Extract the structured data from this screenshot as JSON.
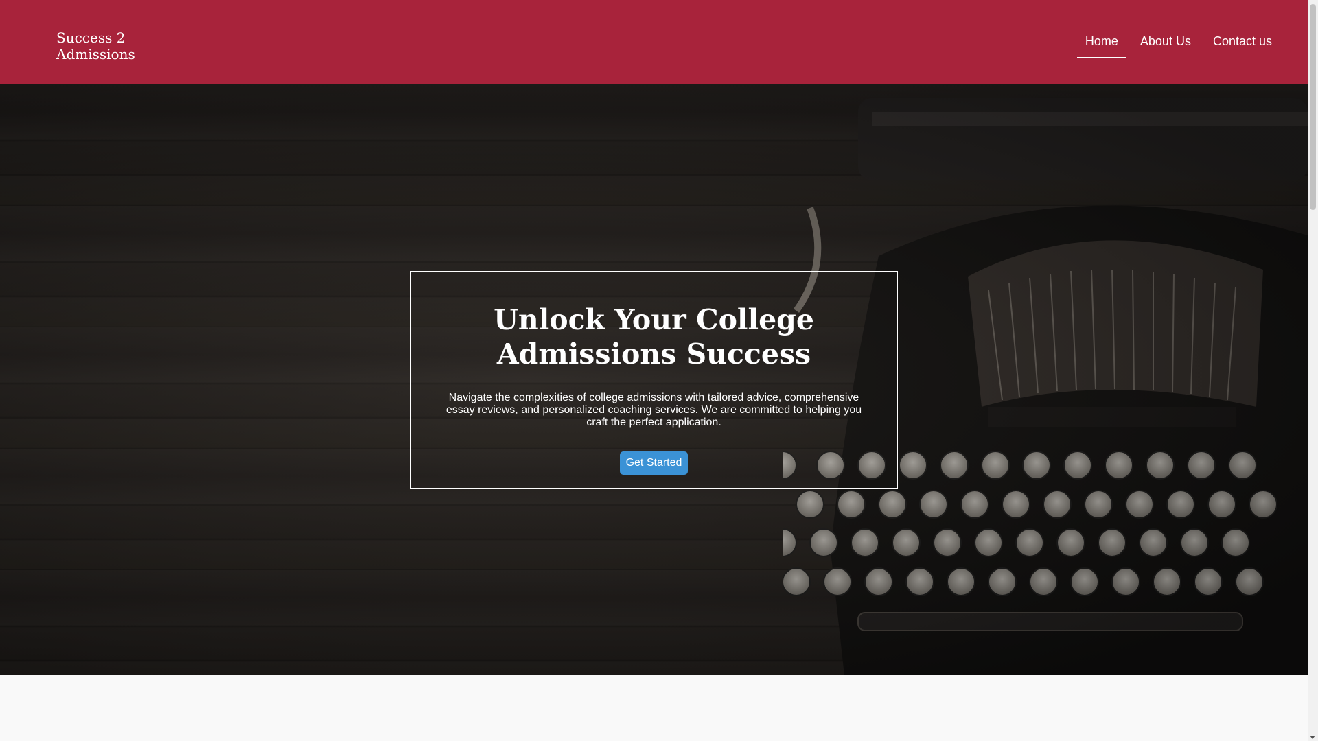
{
  "header": {
    "logo": "Success 2\nAdmissions",
    "nav": [
      {
        "label": "Home",
        "active": true
      },
      {
        "label": "About Us",
        "active": false
      },
      {
        "label": "Contact us",
        "active": false
      }
    ],
    "background_color": "#a8233b"
  },
  "hero": {
    "title": "Unlock Your College\nAdmissions Success",
    "text": "Navigate the complexities of college admissions with tailored advice, comprehensive essay reviews, and personalized coaching services. We are committed to helping you craft the perfect application.",
    "cta_label": "Get Started",
    "cta_color": "#3b92d6",
    "background_image": "typewriter-on-wooden-table"
  }
}
